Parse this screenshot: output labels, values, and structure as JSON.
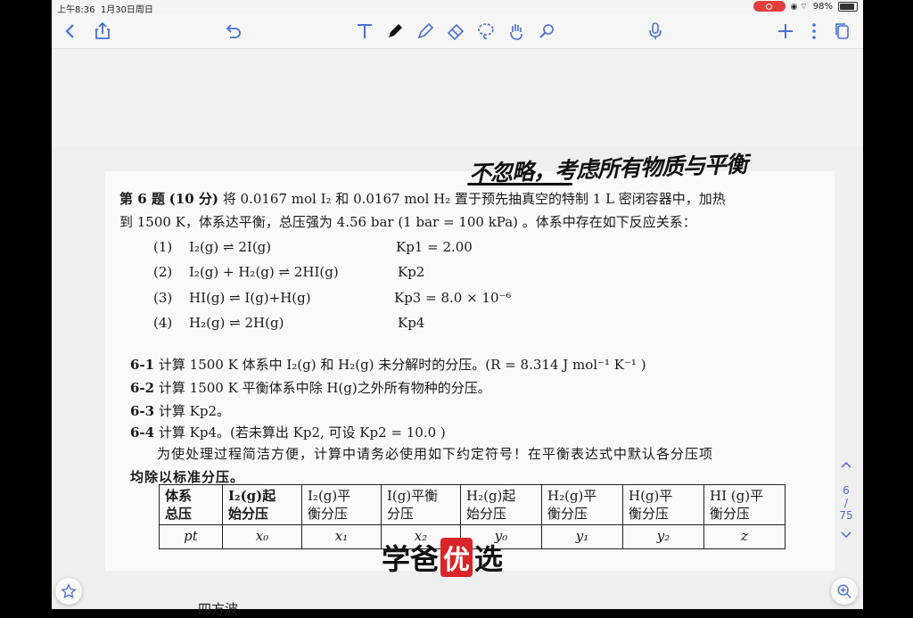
{
  "status": {
    "time": "上午8:36",
    "date": "1月30日周日",
    "battery": "98%"
  },
  "pager": {
    "current": "6",
    "sep": "/",
    "total": "75"
  },
  "handwriting": "不忽略，考虑所有物质与平衡",
  "question": {
    "title": "第 6 题",
    "points": "(10 分)",
    "intro": "将 0.0167 mol I₂ 和 0.0167 mol H₂ 置于预先抽真空的特制 1 L 密闭容器中，加热",
    "line2": "到 1500 K，体系达平衡，总压强为 4.56 bar (1 bar = 100 kPa) 。体系中存在如下反应关系：",
    "reactions": [
      {
        "no": "(1)",
        "eq": "I₂(g) ⇌ 2I(g)",
        "k": "Kp1 = 2.00"
      },
      {
        "no": "(2)",
        "eq": "I₂(g) + H₂(g) ⇌ 2HI(g)",
        "k": "Kp2"
      },
      {
        "no": "(3)",
        "eq": "HI(g) ⇌ I(g)+H(g)",
        "k": "Kp3 = 8.0 × 10⁻⁶"
      },
      {
        "no": "(4)",
        "eq": "H₂(g) ⇌ 2H(g)",
        "k": "Kp4"
      }
    ],
    "subs": [
      {
        "no": "6-1",
        "text": "计算 1500 K 体系中 I₂(g) 和 H₂(g) 未分解时的分压。(R = 8.314 J mol⁻¹ K⁻¹ )"
      },
      {
        "no": "6-2",
        "text": "计算 1500 K 平衡体系中除 H(g)之外所有物种的分压。"
      },
      {
        "no": "6-3",
        "text": "计算 Kp2。"
      },
      {
        "no": "6-4",
        "text": "计算 Kp4。(若未算出 Kp2, 可设 Kp2 = 10.0 )"
      }
    ],
    "note1": "为使处理过程简洁方便，计算中请务必使用如下约定符号！在平衡表达式中默认各分压项",
    "note2": "均除以标准分压。",
    "table": {
      "head": [
        [
          "体系",
          "总压"
        ],
        [
          "I₂(g)起",
          "始分压"
        ],
        [
          "I₂(g)平",
          "衡分压"
        ],
        [
          "I(g)平衡",
          "分压"
        ],
        [
          "H₂(g)起",
          "始分压"
        ],
        [
          "H₂(g)平",
          "衡分压"
        ],
        [
          "H(g)平",
          "衡分压"
        ],
        [
          "HI (g)平",
          "衡分压"
        ]
      ],
      "symbols": [
        "pt",
        "x₀",
        "x₁",
        "x₂",
        "y₀",
        "y₁",
        "y₂",
        "z"
      ]
    }
  },
  "watermark": {
    "a": "学爸",
    "b": "优",
    "c": "选"
  },
  "bottom": "四方波"
}
